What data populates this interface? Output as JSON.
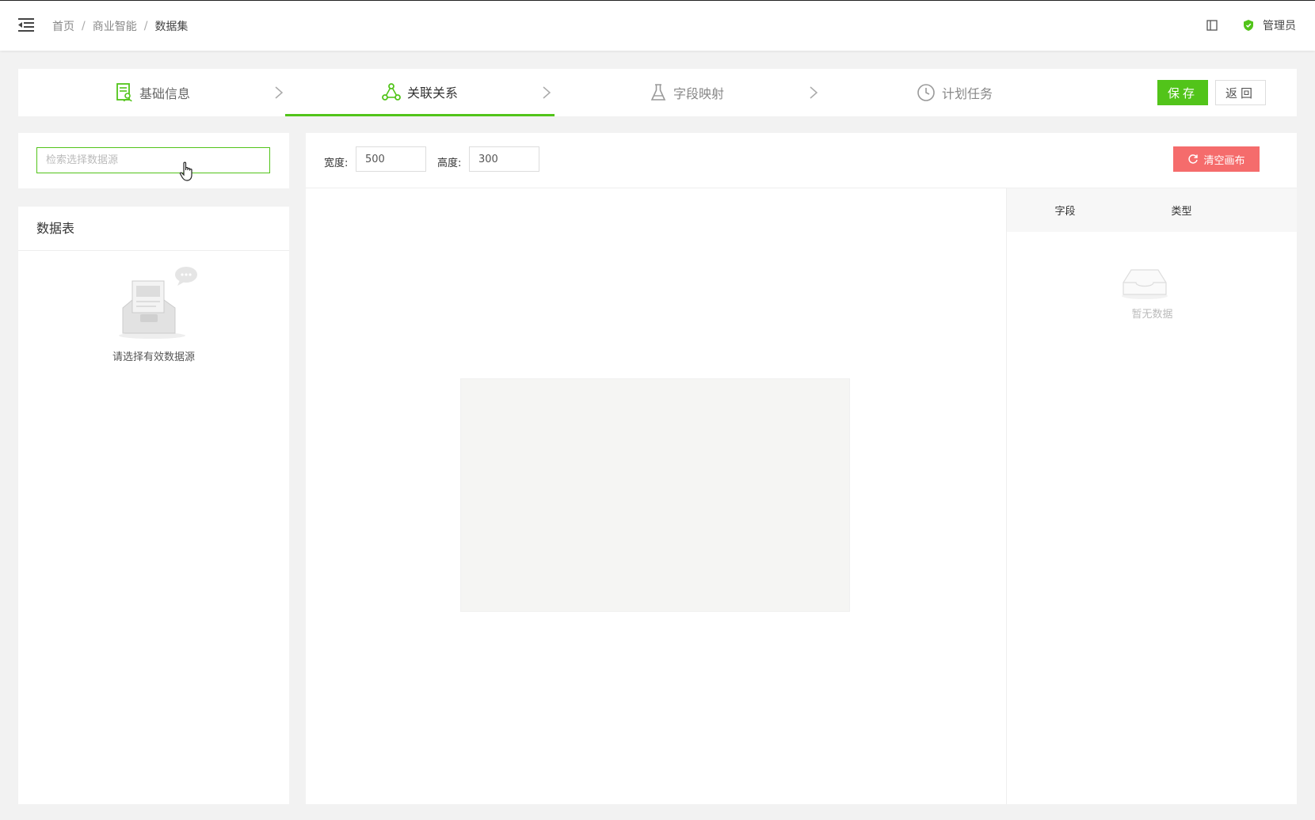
{
  "header": {
    "breadcrumb": [
      "首页",
      "商业智能",
      "数据集"
    ],
    "separator": "/",
    "user": "管理员"
  },
  "steps": [
    {
      "label": "基础信息",
      "icon": "document-user-icon"
    },
    {
      "label": "关联关系",
      "icon": "relation-graph-icon",
      "active": true
    },
    {
      "label": "字段映射",
      "icon": "flask-icon"
    },
    {
      "label": "计划任务",
      "icon": "clock-icon"
    }
  ],
  "actions": {
    "save": "保存",
    "back": "返回"
  },
  "left": {
    "search_placeholder": "检索选择数据源",
    "tables_title": "数据表",
    "empty_text": "请选择有效数据源"
  },
  "toolbar": {
    "width_label": "宽度:",
    "width_value": "500",
    "height_label": "高度:",
    "height_value": "300",
    "clear_label": "清空画布"
  },
  "fields": {
    "col_field": "字段",
    "col_type": "类型",
    "empty_text": "暂无数据"
  },
  "colors": {
    "accent": "#52c41a",
    "danger": "#f56c6c"
  }
}
